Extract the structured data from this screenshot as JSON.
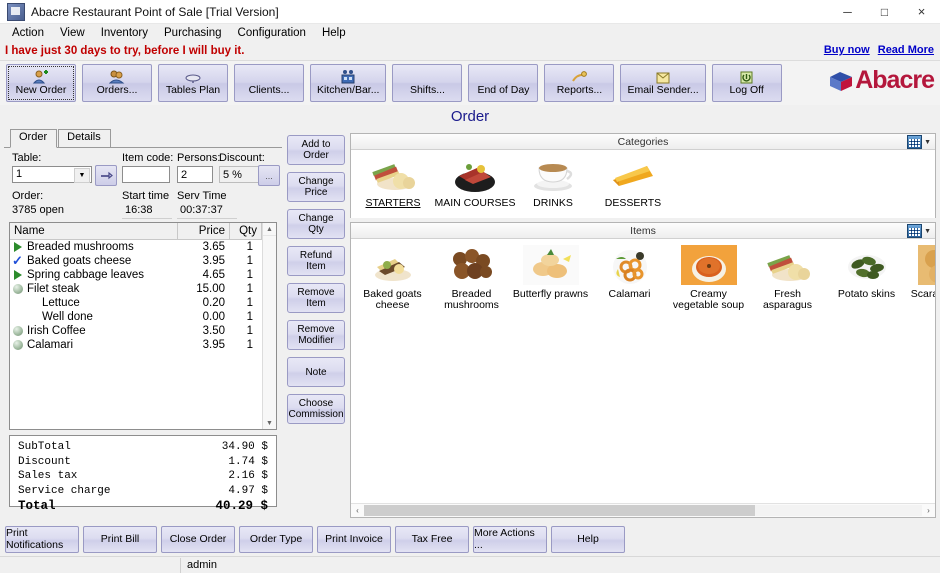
{
  "window": {
    "title": "Abacre Restaurant Point of Sale [Trial Version]",
    "minimize": "─",
    "maximize": "□",
    "close": "×"
  },
  "menu": [
    "Action",
    "View",
    "Inventory",
    "Purchasing",
    "Configuration",
    "Help"
  ],
  "trial": {
    "message": "I have just 30 days to try, before I will buy it.",
    "buy_now": "Buy now",
    "read_more": "Read More"
  },
  "toolbar": {
    "buttons": [
      {
        "label": "New Order",
        "icon": "new-order-icon",
        "selected": true
      },
      {
        "label": "Orders...",
        "icon": "orders-icon",
        "selected": false
      },
      {
        "label": "Tables Plan",
        "icon": "tables-plan-icon",
        "selected": false
      },
      {
        "label": "Clients...",
        "icon": "clients-icon",
        "selected": false
      },
      {
        "label": "Kitchen/Bar...",
        "icon": "kitchen-bar-icon",
        "selected": false
      },
      {
        "label": "Shifts...",
        "icon": "shifts-icon",
        "selected": false
      },
      {
        "label": "End of Day",
        "icon": "end-of-day-icon",
        "selected": false
      },
      {
        "label": "Reports...",
        "icon": "reports-icon",
        "selected": false
      },
      {
        "label": "Email Sender...",
        "icon": "email-sender-icon",
        "selected": false
      },
      {
        "label": "Log Off",
        "icon": "log-off-icon",
        "selected": false
      }
    ],
    "brand": "Abacre"
  },
  "page_title": "Order",
  "order_tabs": [
    {
      "label": "Order",
      "active": true
    },
    {
      "label": "Details",
      "active": false
    }
  ],
  "order_form": {
    "table_label": "Table:",
    "table_value": "1",
    "item_code_label": "Item code:",
    "item_code_value": "",
    "persons_label": "Persons:",
    "persons_value": "2",
    "discount_label": "Discount:",
    "discount_value": "5 %",
    "discount_more": "...",
    "order_label": "Order:",
    "order_value": "3785 open",
    "start_time_label": "Start time",
    "start_time_value": "16:38",
    "serv_time_label": "Serv Time",
    "serv_time_value": "00:37:37"
  },
  "order_list": {
    "columns": [
      "Name",
      "Price",
      "Qty"
    ],
    "rows": [
      {
        "icon": "green-triangle-icon",
        "name": "Breaded mushrooms",
        "price": "3.65",
        "qty": "1",
        "sub": false
      },
      {
        "icon": "blue-check-icon",
        "name": "Baked goats cheese",
        "price": "3.95",
        "qty": "1",
        "sub": false
      },
      {
        "icon": "green-triangle-icon",
        "name": "Spring cabbage leaves",
        "price": "4.65",
        "qty": "1",
        "sub": false
      },
      {
        "icon": "gray-ball-icon",
        "name": "Filet steak",
        "price": "15.00",
        "qty": "1",
        "sub": false
      },
      {
        "icon": "none",
        "name": "Lettuce",
        "price": "0.20",
        "qty": "1",
        "sub": true
      },
      {
        "icon": "none",
        "name": "Well done",
        "price": "0.00",
        "qty": "1",
        "sub": true
      },
      {
        "icon": "gray-ball-icon",
        "name": "Irish Coffee",
        "price": "3.50",
        "qty": "1",
        "sub": false
      },
      {
        "icon": "gray-ball-icon",
        "name": "Calamari",
        "price": "3.95",
        "qty": "1",
        "sub": false
      }
    ]
  },
  "totals": {
    "rows": [
      {
        "label": "SubTotal",
        "value": "34.90 $"
      },
      {
        "label": "Discount",
        "value": "1.74 $"
      },
      {
        "label": "Sales tax",
        "value": "2.16 $"
      },
      {
        "label": "Service charge",
        "value": "4.97 $"
      }
    ],
    "grand_label": "Total",
    "grand_value": "40.29 $"
  },
  "action_buttons": [
    "Add to Order",
    "Change Price",
    "Change Qty",
    "Refund Item",
    "Remove Item",
    "Remove Modifier",
    "Note",
    "Choose Commission"
  ],
  "categories_panel": {
    "title": "Categories",
    "view_icon": "grid-view-icon",
    "items": [
      {
        "label": "STARTERS",
        "icon": "starters-thumb",
        "selected": true
      },
      {
        "label": "MAIN COURSES",
        "icon": "main-courses-thumb",
        "selected": false
      },
      {
        "label": "DRINKS",
        "icon": "drinks-thumb",
        "selected": false
      },
      {
        "label": "DESSERTS",
        "icon": "desserts-thumb",
        "selected": false
      }
    ]
  },
  "items_panel": {
    "title": "Items",
    "view_icon": "grid-view-icon",
    "items": [
      {
        "label": "Baked goats cheese",
        "icon": "baked-goats-cheese-thumb"
      },
      {
        "label": "Breaded mushrooms",
        "icon": "breaded-mushrooms-thumb"
      },
      {
        "label": "Butterfly prawns",
        "icon": "butterfly-prawns-thumb"
      },
      {
        "label": "Calamari",
        "icon": "calamari-thumb"
      },
      {
        "label": "Creamy vegetable soup",
        "icon": "creamy-vegetable-soup-thumb"
      },
      {
        "label": "Fresh asparagus",
        "icon": "fresh-asparagus-thumb"
      },
      {
        "label": "Potato skins",
        "icon": "potato-skins-thumb"
      },
      {
        "label": "Scaramoza c c",
        "icon": "scaramoza-thumb"
      }
    ],
    "scroll_left": "‹",
    "scroll_right": "›"
  },
  "bottom_buttons": [
    "Print Notifications",
    "Print Bill",
    "Close Order",
    "Order Type",
    "Print Invoice",
    "Tax Free",
    "More Actions ...",
    "Help"
  ],
  "statusbar": {
    "user": "admin"
  },
  "colors": {
    "accent": "#1a1a8c",
    "trial_red": "#c00000",
    "link_blue": "#0000c8",
    "brand_red": "#b4173c",
    "button_face": "#d4d4ec"
  }
}
